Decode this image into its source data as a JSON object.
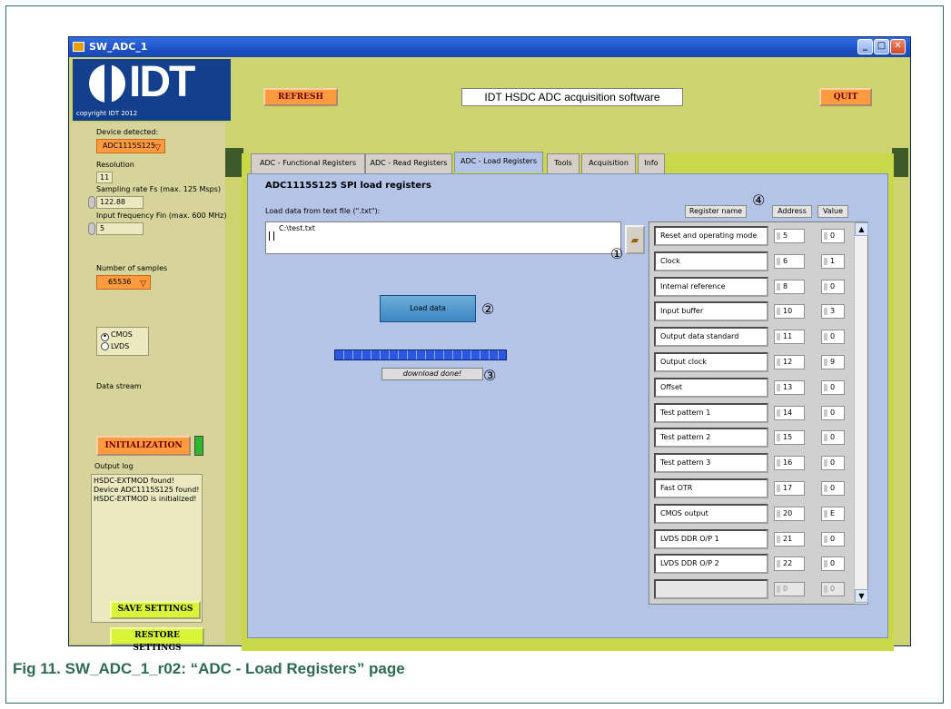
{
  "window": {
    "title": "SW_ADC_1",
    "minimize": "_",
    "maximize": "□",
    "close": "✕"
  },
  "logo": {
    "word": "IDT",
    "copyright": "copyright IDT 2012"
  },
  "header": {
    "refresh_label": "REFRESH",
    "app_title": "IDT HSDC ADC acquisition software",
    "quit_label": "QUIT"
  },
  "left_panel": {
    "device_label": "Device detected:",
    "device_value": "ADC1115S125",
    "resolution_label": "Resolution",
    "resolution_value": "11",
    "sampling_label": "Sampling rate Fs (max. 125 Msps)",
    "sampling_value": "122.88",
    "input_freq_label": "Input frequency Fin (max. 600 MHz)",
    "input_freq_value": "5",
    "samples_label": "Number of samples",
    "samples_value": "65536",
    "data_stream_label": "Data stream",
    "data_stream_options": [
      "CMOS",
      "LVDS"
    ],
    "data_stream_selected": "CMOS",
    "initialization_label": "INITIALIZATION",
    "output_log_label": "Output log",
    "output_log_lines": [
      "HSDC-EXTMOD found!",
      "Device ADC1115S125 found!",
      "HSDC-EXTMOD is initialized!"
    ],
    "save_label": "SAVE SETTINGS",
    "restore_label": "RESTORE SETTINGS"
  },
  "tabs": [
    {
      "label": "ADC - Functional Registers"
    },
    {
      "label": "ADC - Read Registers"
    },
    {
      "label": "ADC - Load Registers"
    },
    {
      "label": "Tools"
    },
    {
      "label": "Acquisition"
    },
    {
      "label": "Info"
    }
  ],
  "active_tab": "ADC - Load Registers",
  "load_page": {
    "section_title": "ADC1115S125 SPI load registers",
    "file_label": "Load data from text file (\".txt\"):",
    "file_path": "C:\\test.txt",
    "load_button": "Load data",
    "progress": 1.0,
    "status": "download done!"
  },
  "callouts": {
    "one": "①",
    "two": "②",
    "three": "③",
    "four": "④"
  },
  "registers": {
    "headers": {
      "name": "Register name",
      "address": "Address",
      "value": "Value"
    },
    "rows": [
      {
        "name": "Reset and operating mode",
        "address": "5",
        "value": "0"
      },
      {
        "name": "Clock",
        "address": "6",
        "value": "1"
      },
      {
        "name": "Internal reference",
        "address": "8",
        "value": "0"
      },
      {
        "name": "Input buffer",
        "address": "10",
        "value": "3"
      },
      {
        "name": "Output data standard",
        "address": "11",
        "value": "0"
      },
      {
        "name": "Output clock",
        "address": "12",
        "value": "9"
      },
      {
        "name": "Offset",
        "address": "13",
        "value": "0"
      },
      {
        "name": "Test pattern 1",
        "address": "14",
        "value": "0"
      },
      {
        "name": "Test pattern 2",
        "address": "15",
        "value": "0"
      },
      {
        "name": "Test pattern 3",
        "address": "16",
        "value": "0"
      },
      {
        "name": "Fast OTR",
        "address": "17",
        "value": "0"
      },
      {
        "name": "CMOS output",
        "address": "20",
        "value": "E"
      },
      {
        "name": "LVDS DDR O/P 1",
        "address": "21",
        "value": "0"
      },
      {
        "name": "LVDS DDR O/P 2",
        "address": "22",
        "value": "0"
      },
      {
        "name": "",
        "address": "0",
        "value": "0"
      }
    ],
    "scroll_up": "▲",
    "scroll_down": "▼"
  },
  "caption": "Fig 11. SW_ADC_1_r02: “ADC - Load Registers” page",
  "colors": {
    "accent_orange": "#ff9a3e",
    "panel_green": "#c8d848",
    "tab_blue": "#b4c4e6"
  }
}
